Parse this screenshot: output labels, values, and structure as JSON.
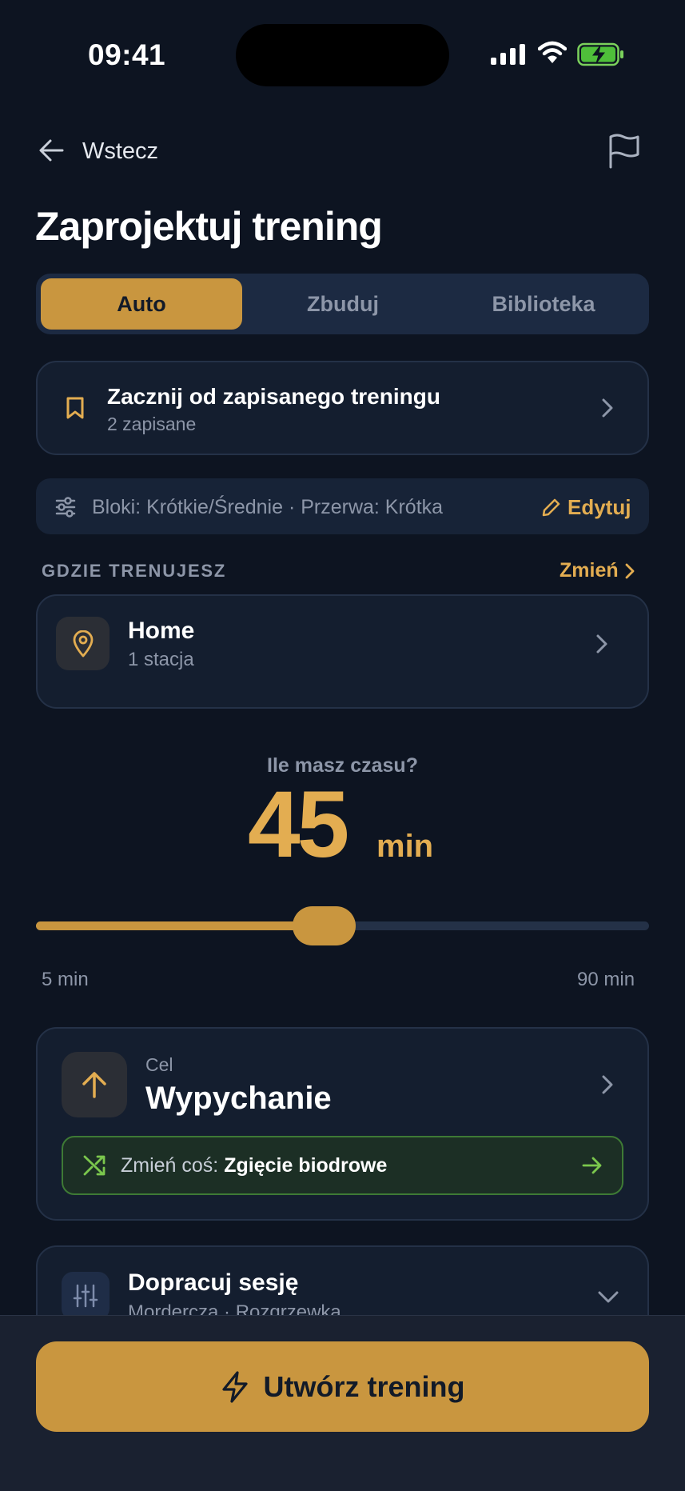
{
  "status_bar": {
    "time": "09:41"
  },
  "nav": {
    "back_label": "Wstecz"
  },
  "page": {
    "title": "Zaprojektuj trening"
  },
  "tabs": [
    {
      "label": "Auto",
      "active": true
    },
    {
      "label": "Zbuduj",
      "active": false
    },
    {
      "label": "Biblioteka",
      "active": false
    }
  ],
  "saved": {
    "title": "Zacznij od zapisanego treningu",
    "subtitle": "2 zapisane"
  },
  "preferences": {
    "summary": "Bloki: Krótkie/Średnie · Przerwa: Krótka",
    "edit_label": "Edytuj"
  },
  "location_section": {
    "label": "GDZIE TRENUJESZ",
    "change_label": "Zmień"
  },
  "location": {
    "name": "Home",
    "detail": "1 stacja"
  },
  "duration": {
    "question": "Ile masz czasu?",
    "value": "45",
    "unit": "min",
    "min_label": "5 min",
    "max_label": "90 min",
    "fraction": 0.47
  },
  "goal": {
    "caption": "Cel",
    "title": "Wypychanie",
    "swap_prefix": "Zmień coś: ",
    "swap_target": "Zgięcie biodrowe"
  },
  "refine": {
    "title": "Dopracuj sesję",
    "subtitle": "Mordercza · Rozgrzewka"
  },
  "cta": {
    "label": "Utwórz trening"
  },
  "colors": {
    "accent": "#c9963f",
    "accent_text": "#e3ad51",
    "background": "#0d1421",
    "card": "#141e2f",
    "success": "#3e7a35"
  }
}
